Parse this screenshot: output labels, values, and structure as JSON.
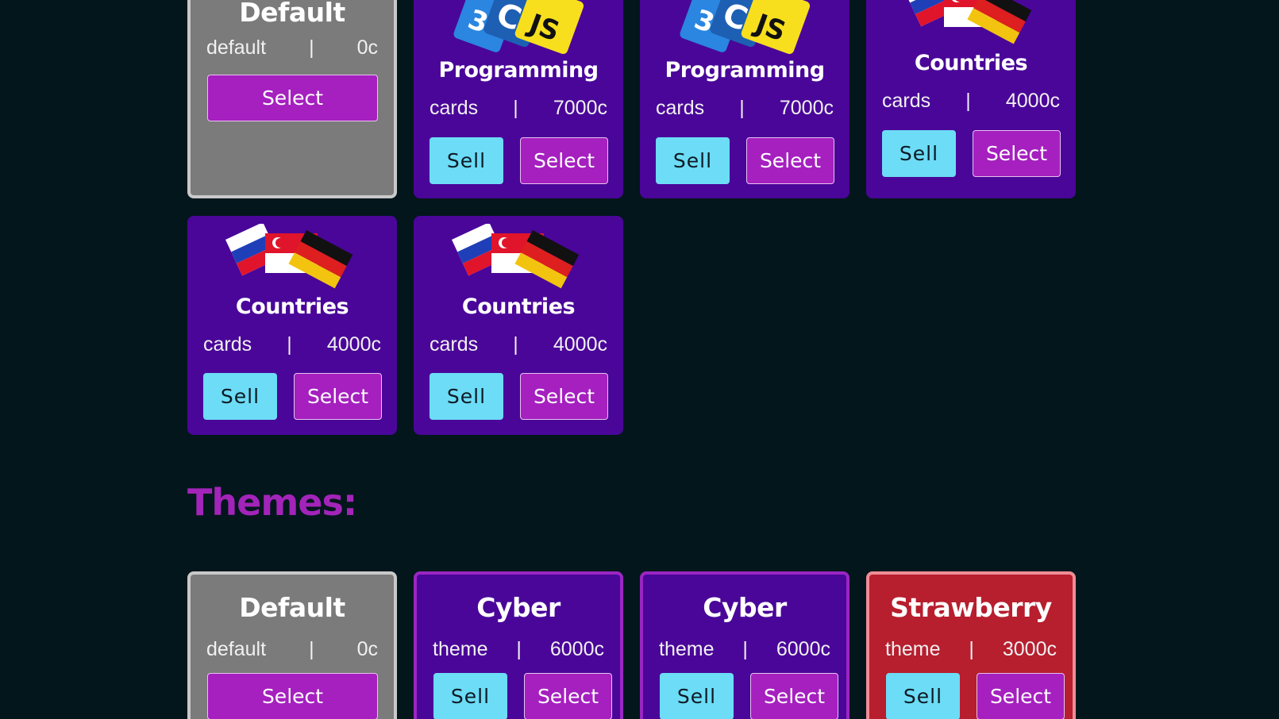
{
  "sections": {
    "themes_heading": "Themes:"
  },
  "decks": [
    {
      "kind": "default",
      "title": "Default",
      "type": "default",
      "sep": "|",
      "price": "0c",
      "select": "Select"
    },
    {
      "kind": "programming",
      "title": "Programming",
      "type": "cards",
      "sep": "|",
      "price": "7000c",
      "sell": "Sell",
      "select": "Select",
      "icon": "programming-icon"
    },
    {
      "kind": "programming",
      "title": "Programming",
      "type": "cards",
      "sep": "|",
      "price": "7000c",
      "sell": "Sell",
      "select": "Select",
      "icon": "programming-icon"
    },
    {
      "kind": "countries",
      "title": "Countries",
      "type": "cards",
      "sep": "|",
      "price": "4000c",
      "sell": "Sell",
      "select": "Select",
      "icon": "flags-icon"
    },
    {
      "kind": "countries",
      "title": "Countries",
      "type": "cards",
      "sep": "|",
      "price": "4000c",
      "sell": "Sell",
      "select": "Select",
      "icon": "flags-icon"
    },
    {
      "kind": "countries",
      "title": "Countries",
      "type": "cards",
      "sep": "|",
      "price": "4000c",
      "sell": "Sell",
      "select": "Select",
      "icon": "flags-icon"
    }
  ],
  "themes": [
    {
      "kind": "default",
      "title": "Default",
      "type": "default",
      "sep": "|",
      "price": "0c",
      "select": "Select"
    },
    {
      "kind": "cyber",
      "title": "Cyber",
      "type": "theme",
      "sep": "|",
      "price": "6000c",
      "sell": "Sell",
      "select": "Select"
    },
    {
      "kind": "cyber",
      "title": "Cyber",
      "type": "theme",
      "sep": "|",
      "price": "6000c",
      "sell": "Sell",
      "select": "Select"
    },
    {
      "kind": "strawberry",
      "title": "Strawberry",
      "type": "theme",
      "sep": "|",
      "price": "3000c",
      "sell": "Sell",
      "select": "Select"
    }
  ],
  "colors": {
    "background": "#02161c",
    "card_purple": "#4a0699",
    "card_default": "#7b7b7b",
    "card_strawberry": "#b71e2e",
    "sell_button": "#6ddcf6",
    "select_button": "#a520bf",
    "heading": "#a324b9"
  }
}
